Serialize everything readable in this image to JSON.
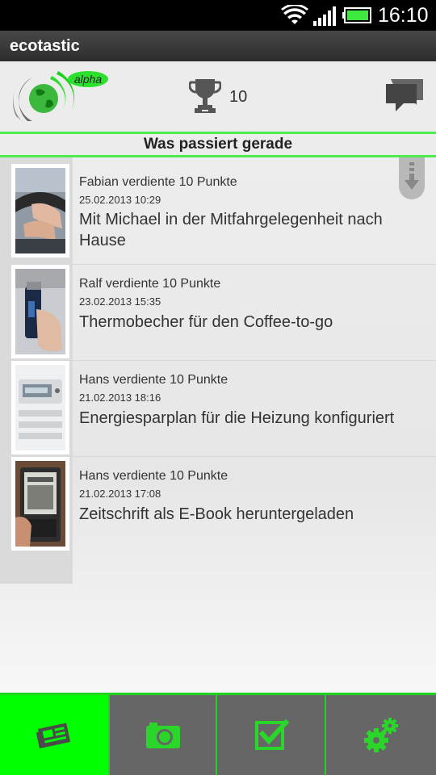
{
  "status_bar": {
    "time": "16:10"
  },
  "app": {
    "title": "ecotastic"
  },
  "header": {
    "logo_badge": "alpha",
    "score": "10"
  },
  "section": {
    "title": "Was passiert gerade"
  },
  "feed": [
    {
      "who": "Fabian verdiente 10 Punkte",
      "when": "25.02.2013 10:29",
      "what": "Mit Michael in der Mitfahrgelegenheit nach Hause",
      "image": "car-steering-photo"
    },
    {
      "who": "Ralf verdiente 10 Punkte",
      "when": "23.02.2013 15:35",
      "what": "Thermobecher für den Coffee-to-go",
      "image": "thermo-mug-photo"
    },
    {
      "who": "Hans verdiente 10 Punkte",
      "when": "21.02.2013 18:16",
      "what": "Energiesparplan für die Heizung konfiguriert",
      "image": "heating-controller-photo"
    },
    {
      "who": "Hans verdiente 10 Punkte",
      "when": "21.02.2013 17:08",
      "what": "Zeitschrift als E-Book heruntergeladen",
      "image": "ebook-reader-photo"
    }
  ],
  "tabs": [
    {
      "icon": "newspaper-icon",
      "active": true
    },
    {
      "icon": "camera-icon",
      "active": false
    },
    {
      "icon": "checkbox-icon",
      "active": false
    },
    {
      "icon": "gears-icon",
      "active": false
    }
  ],
  "colors": {
    "accent": "#00ff00",
    "tab_inactive": "#666666",
    "icon_green": "#2bd62b"
  }
}
